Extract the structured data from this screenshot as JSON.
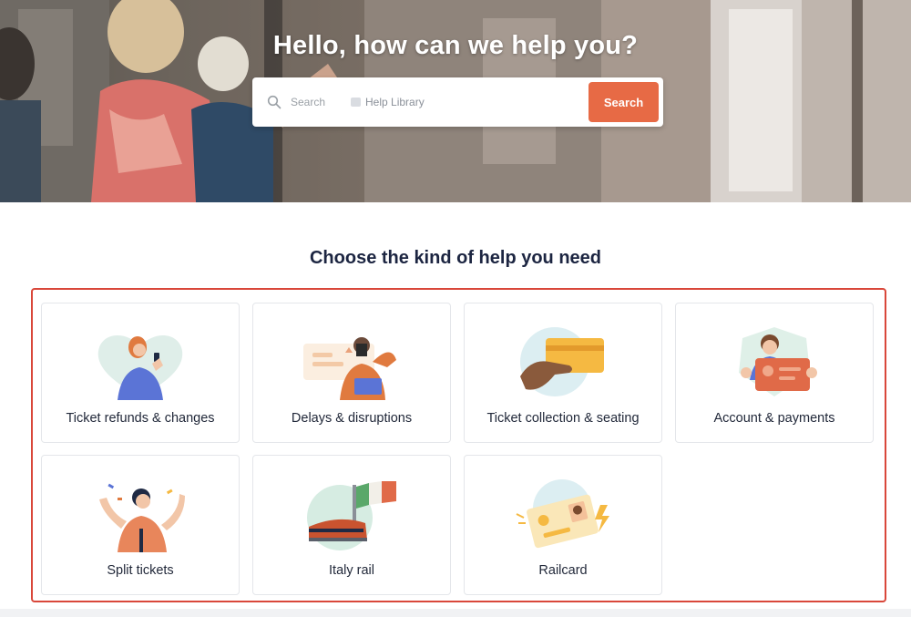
{
  "hero": {
    "title": "Hello, how can we help you?",
    "search": {
      "placeholder": "Search",
      "filter_label": "Help Library",
      "button_label": "Search"
    }
  },
  "section": {
    "title": "Choose the kind of help you need"
  },
  "categories": [
    {
      "label": "Ticket refunds & changes",
      "icon": "refund-illustration"
    },
    {
      "label": "Delays & disruptions",
      "icon": "delay-illustration"
    },
    {
      "label": "Ticket collection & seating",
      "icon": "ticket-card-illustration"
    },
    {
      "label": "Account & payments",
      "icon": "account-illustration"
    },
    {
      "label": "Split tickets",
      "icon": "celebration-illustration"
    },
    {
      "label": "Italy rail",
      "icon": "italy-train-illustration"
    },
    {
      "label": "Railcard",
      "icon": "railcard-illustration"
    }
  ],
  "colors": {
    "accent": "#e76a45",
    "highlight_border": "#d9473a",
    "title": "#1c2541"
  }
}
